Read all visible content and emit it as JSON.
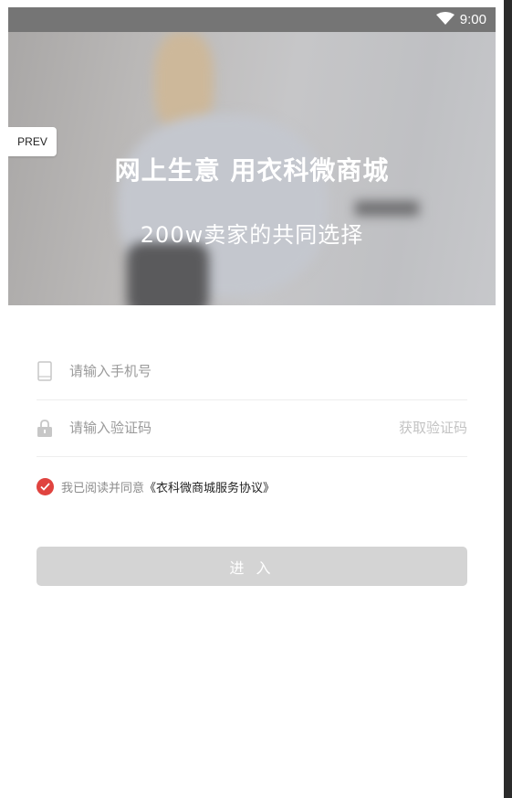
{
  "status_bar": {
    "time": "9:00",
    "wifi_icon": "wifi-icon"
  },
  "hero": {
    "title": "网上生意 用衣科微商城",
    "subtitle": "200w卖家的共同选择"
  },
  "prev_button": {
    "label": "PREV"
  },
  "form": {
    "phone": {
      "placeholder": "请输入手机号",
      "value": "",
      "icon": "phone-icon"
    },
    "code": {
      "placeholder": "请输入验证码",
      "value": "",
      "icon": "lock-icon",
      "get_code_label": "获取验证码"
    }
  },
  "agreement": {
    "checked": true,
    "text": "我已阅读并同意",
    "link": "《衣科微商城服务协议》"
  },
  "submit": {
    "label": "进 入"
  },
  "colors": {
    "accent": "#e0433f",
    "button_disabled": "#d4d4d4",
    "status_bar": "#757575"
  }
}
